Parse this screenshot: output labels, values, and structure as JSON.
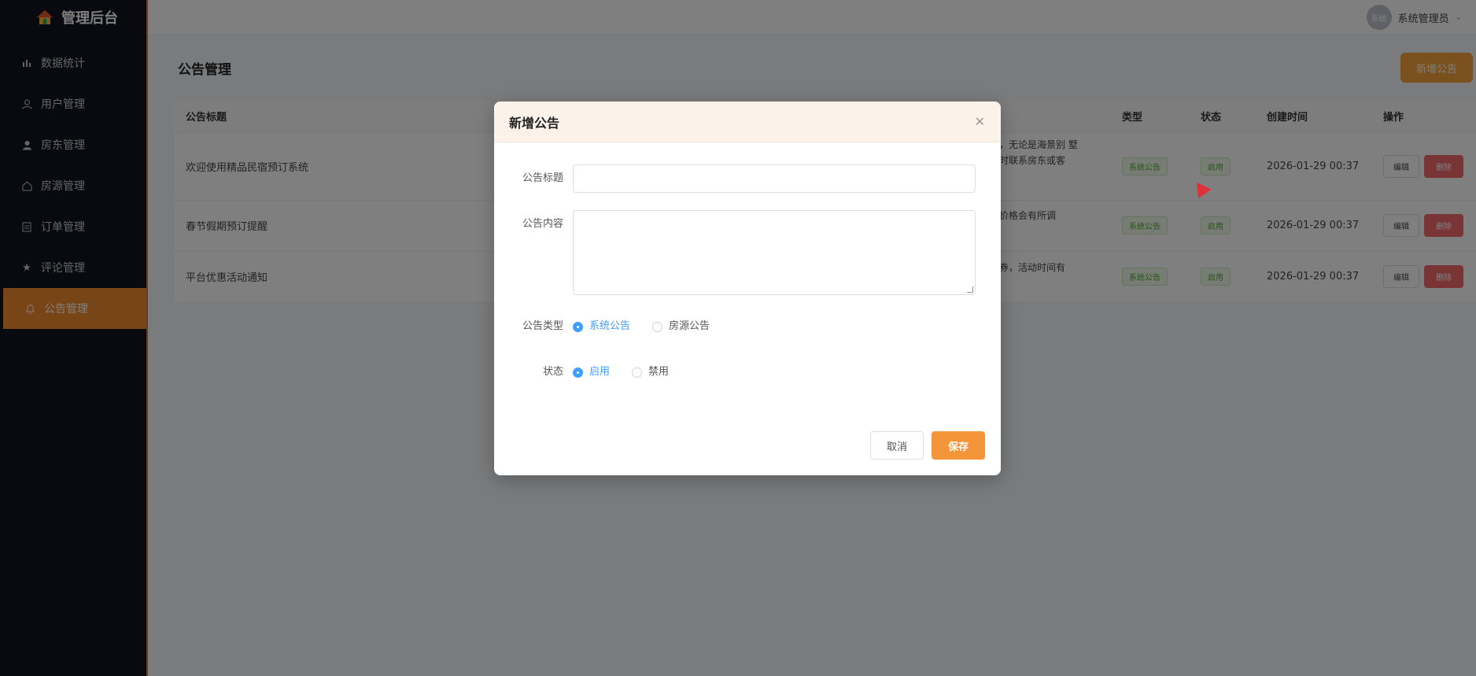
{
  "sidebar": {
    "brand": "管理后台",
    "items": [
      {
        "label": "数据统计",
        "icon": "bar-chart-icon"
      },
      {
        "label": "用户管理",
        "icon": "user-icon"
      },
      {
        "label": "房东管理",
        "icon": "person-icon"
      },
      {
        "label": "房源管理",
        "icon": "house-icon"
      },
      {
        "label": "订单管理",
        "icon": "document-icon"
      },
      {
        "label": "评论管理",
        "icon": "star-icon"
      },
      {
        "label": "公告管理",
        "icon": "bell-icon"
      }
    ]
  },
  "header": {
    "avatar_text": "系统",
    "username": "系统管理员"
  },
  "main": {
    "title": "公告管理",
    "add_button": "新增公告",
    "table": {
      "headers": [
        "公告标题",
        "类型",
        "状态",
        "创建时间",
        "操作"
      ],
      "rows": [
        {
          "title": "欢迎使用精品民宿预订系统",
          "content": "宿，无论是海景别 墅随时联系房东或客",
          "type": "系统公告",
          "status": "启用",
          "created": "2026-01-29 00:37"
        },
        {
          "title": "春节假期预订提醒",
          "content": "宿价格会有所调",
          "type": "系统公告",
          "status": "启用",
          "created": "2026-01-29 00:37"
        },
        {
          "title": "平台优惠活动通知",
          "content": "惠券，活动时间有",
          "type": "系统公告",
          "status": "启用",
          "created": "2026-01-29 00:37"
        }
      ],
      "edit_label": "编辑",
      "delete_label": "删除"
    }
  },
  "dialog": {
    "title": "新增公告",
    "title_label": "公告标题",
    "content_label": "公告内容",
    "type_label": "公告类型",
    "type_options": [
      "系统公告",
      "房源公告"
    ],
    "status_label": "状态",
    "status_options": [
      "启用",
      "禁用"
    ],
    "cancel": "取消",
    "save": "保存"
  },
  "colors": {
    "accent": "#f5953a",
    "sidebar_bg": "#13141f",
    "radio_checked": "#409eff",
    "danger": "#f26b6b"
  }
}
